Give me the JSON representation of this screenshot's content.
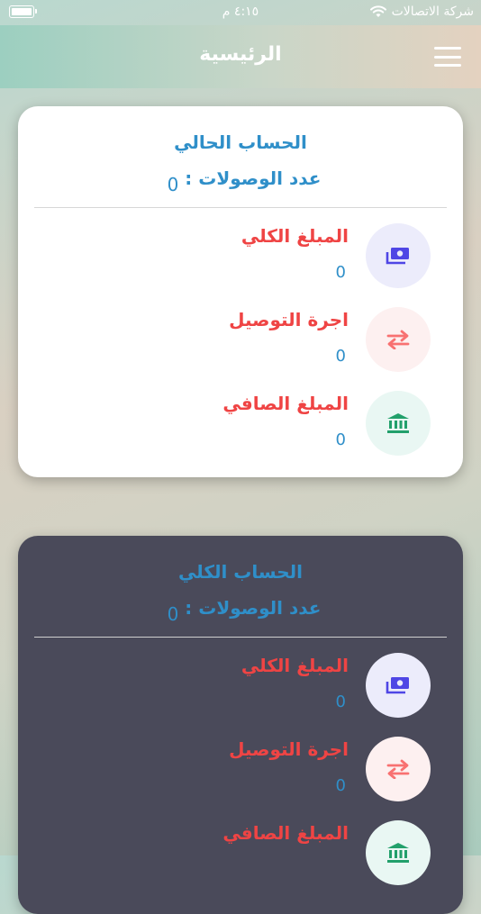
{
  "status_bar": {
    "carrier": "شركة الاتصالات",
    "time": "٤:١٥ م"
  },
  "header": {
    "title": "الرئيسية"
  },
  "current_account": {
    "title": "الحساب الحالي",
    "count_label": "عدد الوصولات :",
    "count_value": "0",
    "items": [
      {
        "label": "المبلغ الكلي",
        "value": "0",
        "icon": "money-icon"
      },
      {
        "label": "اجرة التوصيل",
        "value": "0",
        "icon": "swap-arrows-icon"
      },
      {
        "label": "المبلغ الصافي",
        "value": "0",
        "icon": "bank-icon"
      }
    ]
  },
  "total_account": {
    "title": "الحساب الكلي",
    "count_label": "عدد الوصولات :",
    "count_value": "0",
    "items": [
      {
        "label": "المبلغ الكلي",
        "value": "0",
        "icon": "money-icon"
      },
      {
        "label": "اجرة التوصيل",
        "value": "0",
        "icon": "swap-arrows-icon"
      },
      {
        "label": "المبلغ الصافي",
        "value": "",
        "icon": "bank-icon"
      }
    ]
  },
  "colors": {
    "title_blue": "#2f8fc9",
    "label_red": "#ef4444",
    "icon_blue": "#4f46e5",
    "icon_red": "#f87171",
    "icon_green": "#22a06b",
    "dark_card": "#4a4a5a"
  }
}
